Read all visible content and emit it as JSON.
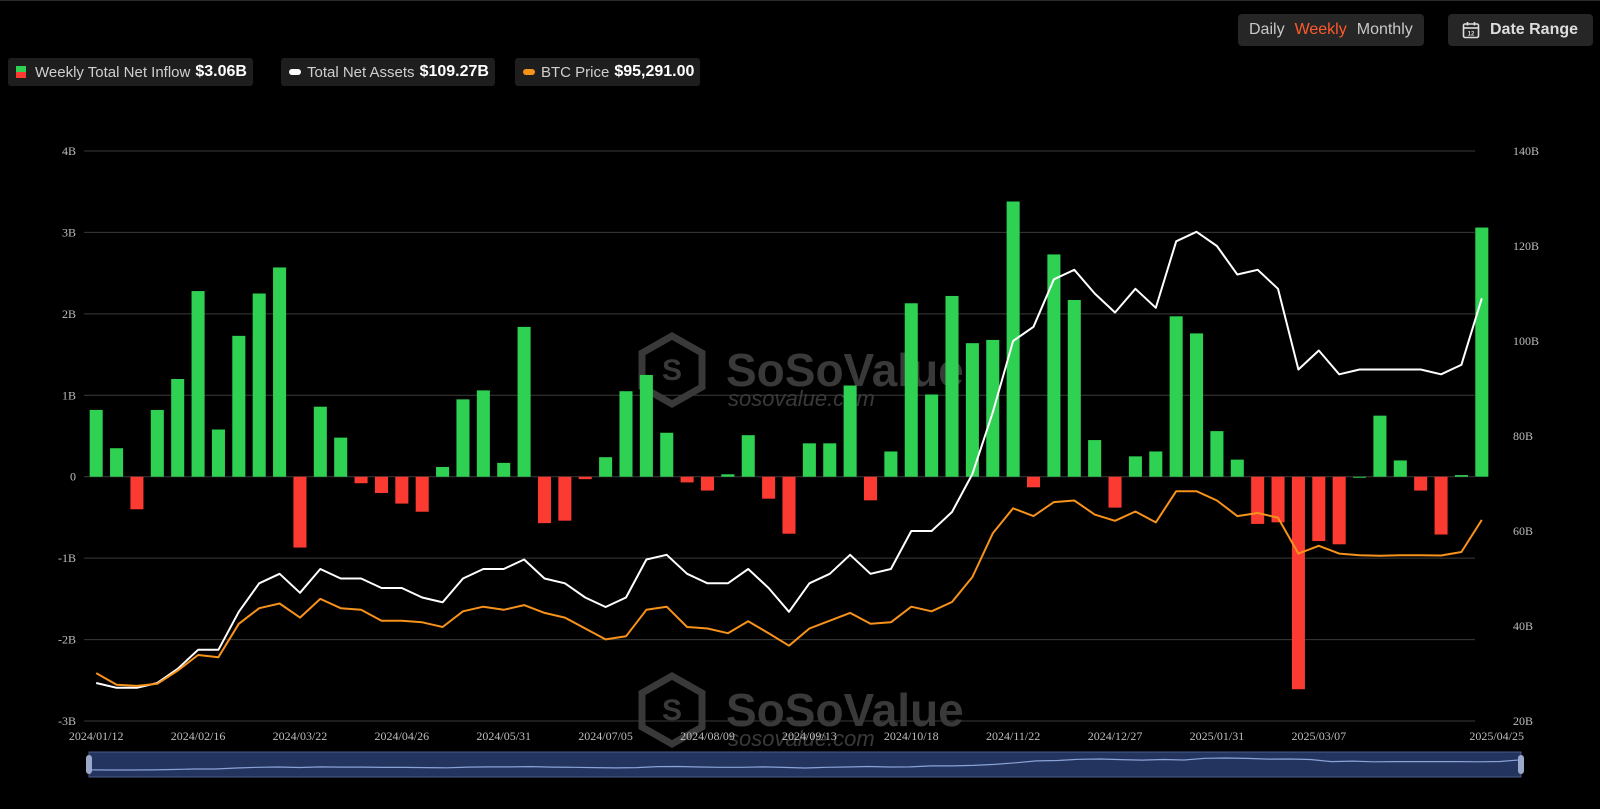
{
  "controls": {
    "periods": [
      "Daily",
      "Weekly",
      "Monthly"
    ],
    "active_period": "Weekly",
    "date_range_label": "Date Range",
    "date_range_icon": "calendar-icon"
  },
  "legend": [
    {
      "label": "Weekly Total Net Inflow",
      "value": "$3.06B"
    },
    {
      "label": "Total Net Assets",
      "value": "$109.27B"
    },
    {
      "label": "BTC Price",
      "value": "$95,291.00"
    }
  ],
  "watermark": {
    "brand": "SoSoValue",
    "url": "sosovalue.com"
  },
  "colors": {
    "positive": "#2fd152",
    "negative": "#fb3a31",
    "assets_line": "#ffffff",
    "btc_line": "#f7921a",
    "active_period": "#ff5a2a",
    "slider": "#23355f"
  },
  "chart_data": {
    "type": "bar",
    "x_ticks": [
      "2024/01/12",
      "2024/02/16",
      "2024/03/22",
      "2024/04/26",
      "2024/05/31",
      "2024/07/05",
      "2024/08/09",
      "2024/09/13",
      "2024/10/18",
      "2024/11/22",
      "2024/12/27",
      "2025/01/31",
      "2025/03/07",
      "2025/04/25"
    ],
    "y_left_ticks": [
      "4B",
      "3B",
      "2B",
      "1B",
      "0",
      "-1B",
      "-2B",
      "-3B"
    ],
    "y_right_ticks": [
      "140B",
      "120B",
      "100B",
      "80B",
      "60B",
      "40B",
      "20B"
    ],
    "y_left_range": [
      -3,
      4
    ],
    "y_right_range": [
      20,
      140
    ],
    "x_range": [
      "2024/01/12",
      "2025/04/25"
    ],
    "week_interval_days": 7,
    "grid": true,
    "series": [
      {
        "name": "Weekly Total Net Inflow",
        "type": "bar",
        "unit": "B USD",
        "values": [
          0.82,
          0.35,
          -0.4,
          0.82,
          1.2,
          2.28,
          0.58,
          1.73,
          2.25,
          2.57,
          -0.87,
          0.86,
          0.48,
          -0.08,
          -0.2,
          -0.33,
          -0.43,
          0.12,
          0.95,
          1.06,
          0.17,
          1.84,
          -0.57,
          -0.54,
          -0.03,
          0.24,
          1.05,
          1.25,
          0.54,
          -0.07,
          -0.17,
          0.03,
          0.51,
          -0.27,
          -0.7,
          0.41,
          0.41,
          1.12,
          -0.29,
          0.31,
          2.13,
          1.01,
          2.22,
          1.64,
          1.68,
          3.38,
          -0.13,
          2.73,
          2.17,
          0.45,
          -0.38,
          0.25,
          0.31,
          1.97,
          1.76,
          0.56,
          0.21,
          -0.58,
          -0.56,
          -2.61,
          -0.79,
          -0.83,
          0.0,
          0.75,
          0.2,
          -0.17,
          -0.71,
          0.02,
          3.06
        ]
      },
      {
        "name": "Total Net Assets",
        "type": "line",
        "axis": "right",
        "unit": "B USD",
        "values": [
          28,
          27,
          27,
          28,
          31,
          35,
          35,
          43,
          49,
          51,
          47,
          52,
          50,
          50,
          48,
          48,
          46,
          45,
          50,
          52,
          52,
          54,
          50,
          49,
          46,
          44,
          46,
          54,
          55,
          51,
          49,
          49,
          52,
          48,
          43,
          49,
          51,
          55,
          51,
          52,
          60,
          60,
          64,
          72,
          85,
          100,
          103,
          113,
          115,
          110,
          106,
          111,
          107,
          121,
          123,
          120,
          114,
          115,
          111,
          94,
          98,
          93,
          94,
          94,
          94,
          94,
          93,
          95,
          109
        ]
      },
      {
        "name": "BTC Price",
        "type": "line",
        "axis": "right",
        "unit": "USD",
        "values": [
          46200,
          42500,
          42100,
          42800,
          47000,
          52000,
          51300,
          62000,
          67000,
          68500,
          64000,
          70000,
          67000,
          66500,
          63000,
          63000,
          62500,
          61000,
          66000,
          67500,
          66500,
          68000,
          65500,
          64000,
          60500,
          57000,
          58000,
          66500,
          67500,
          61000,
          60500,
          59000,
          62800,
          59000,
          55000,
          60500,
          63000,
          65500,
          62000,
          62500,
          67500,
          66000,
          69000,
          77000,
          91000,
          99000,
          96500,
          101000,
          101500,
          97000,
          95000,
          98000,
          94500,
          104500,
          104500,
          101500,
          96500,
          97500,
          96000,
          84500,
          87000,
          84500,
          84000,
          83800,
          84000,
          84000,
          83900,
          85000,
          95291
        ]
      }
    ]
  }
}
